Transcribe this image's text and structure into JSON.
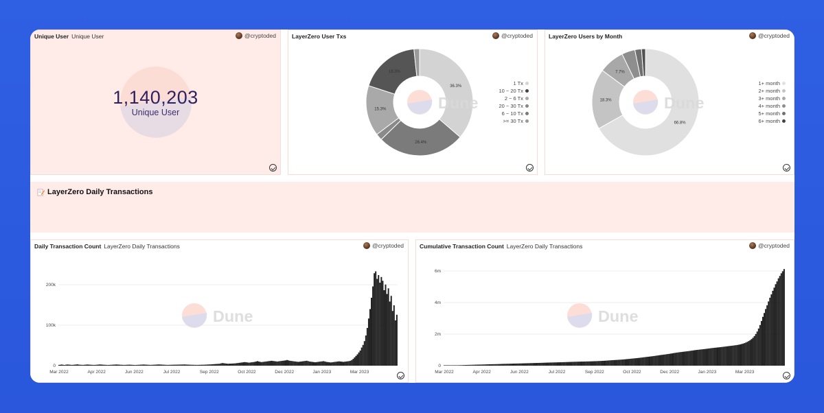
{
  "panels": {
    "unique_user": {
      "title": "Unique User",
      "subtitle": "Unique User",
      "author": "@cryptoded",
      "value": "1,140,203",
      "label": "Unique User"
    },
    "user_txs": {
      "title": "LayerZero User Txs",
      "author": "@cryptoded"
    },
    "users_by_month": {
      "title": "LayerZero Users by Month",
      "author": "@cryptoded"
    },
    "section": {
      "title": "LayerZero Daily Transactions"
    },
    "daily": {
      "title": "Daily Transaction Count",
      "subtitle": "LayerZero Daily Transactions",
      "author": "@cryptoded"
    },
    "cumulative": {
      "title": "Cumulative Transaction Count",
      "subtitle": "LayerZero Daily Transactions",
      "author": "@cryptoded"
    }
  },
  "watermark": "Dune",
  "colors": {
    "panel_pink": "#ffece9",
    "number": "#2f2260",
    "background": "#2f5fe3"
  },
  "chart_data": [
    {
      "type": "pie",
      "id": "user_txs",
      "donut": true,
      "labels": [
        "1 Tx",
        "10 ~ 20 Tx",
        "2 ~ 6 Tx",
        "20 ~ 30 Tx",
        "6 ~ 10 Tx",
        ">= 30 Tx"
      ],
      "values": [
        36.3,
        15.3,
        26.4,
        18.3,
        2.0,
        1.7
      ],
      "value_labels": [
        "36.3%",
        "15.3%",
        "26.4%",
        "18.3%",
        "",
        ""
      ],
      "slice_order": [
        0,
        2,
        4,
        1,
        3,
        5
      ],
      "slice_colors": [
        "#d3d3d3",
        "#a9a9a9",
        "#7b7b7b",
        "#555555",
        "#8a8a8a",
        "#9a9a9a"
      ],
      "legend_colors": [
        "#d3d3d3",
        "#444444",
        "#a9a9a9",
        "#888888",
        "#7b7b7b",
        "#9a9a9a"
      ]
    },
    {
      "type": "pie",
      "id": "users_by_month",
      "donut": true,
      "labels": [
        "1+ month",
        "2+ month",
        "3+ month",
        "4+ month",
        "5+ month",
        "6+ month"
      ],
      "values": [
        66.8,
        18.3,
        7.7,
        4.0,
        2.0,
        1.2
      ],
      "value_labels": [
        "66.8%",
        "18.3%",
        "7.7%",
        "",
        "",
        ""
      ],
      "slice_colors": [
        "#e0e0e0",
        "#c4c4c4",
        "#a8a8a8",
        "#8e8e8e",
        "#707070",
        "#505050"
      ],
      "legend_colors": [
        "#e0e0e0",
        "#c4c4c4",
        "#a8a8a8",
        "#8e8e8e",
        "#707070",
        "#444444"
      ]
    },
    {
      "type": "bar",
      "id": "daily",
      "x_ticks": [
        "Mar 2022",
        "Apr 2022",
        "Jun 2022",
        "Jul 2022",
        "Sep 2022",
        "Oct 2022",
        "Dec 2022",
        "Jan 2023",
        "Mar 2023"
      ],
      "y_ticks": [
        "0",
        "100k",
        "200k"
      ],
      "ylim": [
        0,
        260000
      ],
      "values": [
        2000,
        2500,
        3000,
        2200,
        1800,
        2600,
        3100,
        2800,
        2400,
        2000,
        2200,
        2600,
        3000,
        3500,
        2800,
        2500,
        2200,
        2000,
        2400,
        2600,
        3000,
        2800,
        2500,
        2300,
        2100,
        2000,
        2200,
        2500,
        2800,
        3200,
        3000,
        2600,
        2400,
        2200,
        2000,
        1900,
        2100,
        2300,
        2500,
        2700,
        2900,
        3100,
        2800,
        2600,
        2400,
        2200,
        2000,
        2100,
        2300,
        2500,
        2600,
        2400,
        2200,
        2000,
        1800,
        2000,
        2200,
        2400,
        2600,
        2800,
        3000,
        2800,
        2600,
        2400,
        2200,
        2000,
        2200,
        2400,
        2600,
        2800,
        3000,
        3200,
        3000,
        2800,
        2600,
        2400,
        2200,
        2000,
        2100,
        2200,
        2300,
        2400,
        2500,
        2600,
        2700,
        2800,
        2900,
        3000,
        3100,
        3200,
        3000,
        2800,
        2600,
        2500,
        2400,
        2300,
        2200,
        2100,
        2000,
        2100,
        2200,
        2300,
        2400,
        2500,
        2700,
        2900,
        3100,
        3300,
        3500,
        3800,
        4000,
        4300,
        4500,
        4800,
        5000,
        6000,
        7000,
        6500,
        6000,
        5500,
        5000,
        5200,
        5400,
        5600,
        5800,
        6000,
        6500,
        7000,
        7500,
        8000,
        8500,
        9000,
        9500,
        9000,
        8500,
        8000,
        8500,
        9000,
        9500,
        10000,
        11000,
        12000,
        11000,
        10000,
        9500,
        10000,
        10500,
        11000,
        11500,
        12000,
        12500,
        13000,
        12500,
        12000,
        11500,
        11000,
        11500,
        12000,
        12500,
        13000,
        13500,
        14000,
        15000,
        14000,
        13000,
        12500,
        12000,
        11500,
        11000,
        10500,
        10000,
        10500,
        11000,
        11500,
        12000,
        12500,
        13000,
        12000,
        11000,
        10500,
        10000,
        9500,
        9000,
        9500,
        10000,
        10500,
        11000,
        11500,
        12000,
        11000,
        10000,
        9500,
        9000,
        8500,
        9000,
        9500,
        10000,
        10500,
        11000,
        11500,
        11000,
        10500,
        10000,
        10500,
        11000,
        11500,
        12000,
        13000,
        15000,
        18000,
        22000,
        26000,
        30000,
        35000,
        40000,
        48000,
        55000,
        65000,
        80000,
        100000,
        125000,
        150000,
        180000,
        210000,
        245000,
        250000,
        230000,
        240000,
        220000,
        235000,
        225000,
        200000,
        215000,
        190000,
        205000,
        170000,
        185000,
        145000,
        160000,
        120000,
        135000
      ]
    },
    {
      "type": "bar",
      "id": "cumulative",
      "x_ticks": [
        "Mar 2022",
        "Apr 2022",
        "Jun 2022",
        "Jul 2022",
        "Sep 2022",
        "Oct 2022",
        "Dec 2022",
        "Jan 2023",
        "Mar 2023"
      ],
      "y_ticks": [
        "0",
        "2m",
        "4m",
        "6m"
      ],
      "ylim": [
        0,
        6700000
      ],
      "values_desc": "cumulative sum of daily counts, ending near 6.6m"
    }
  ]
}
